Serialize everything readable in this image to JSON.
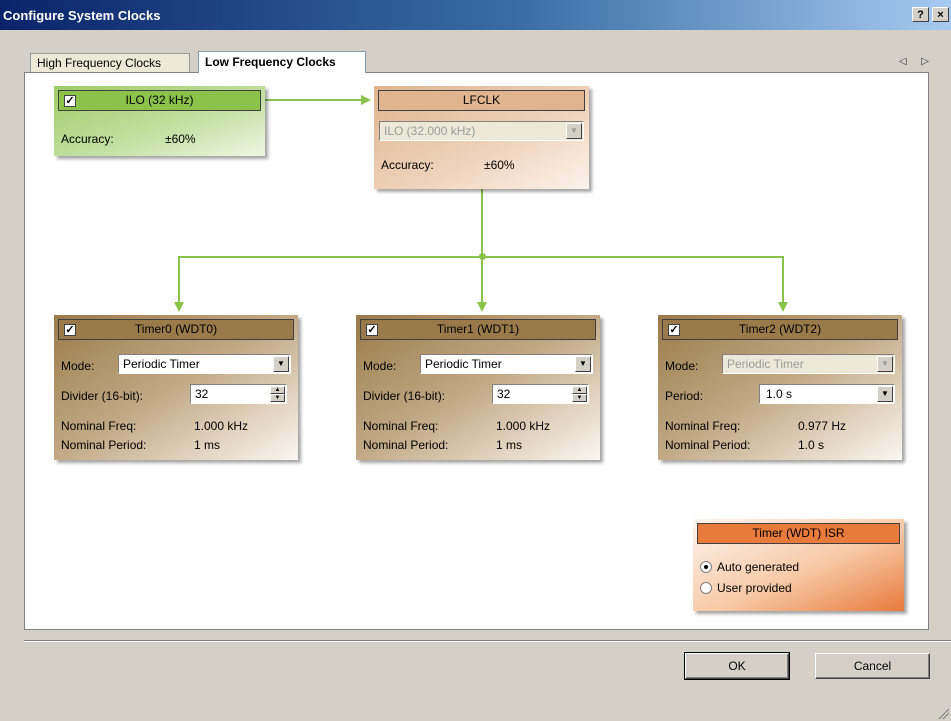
{
  "window": {
    "title": "Configure System Clocks",
    "help_label": "?",
    "close_label": "×"
  },
  "tabs": [
    {
      "label": "High Frequency Clocks",
      "active": false
    },
    {
      "label": "Low Frequency Clocks",
      "active": true
    }
  ],
  "tab_scroll": "◁ ▷",
  "ilo": {
    "header": "ILO (32 kHz)",
    "checked": true,
    "accuracy_label": "Accuracy:",
    "accuracy_value": "±60%"
  },
  "lfclk": {
    "header": "LFCLK",
    "source_value": "ILO (32.000 kHz)",
    "accuracy_label": "Accuracy:",
    "accuracy_value": "±60%"
  },
  "timers": [
    {
      "header": "Timer0 (WDT0)",
      "checked": true,
      "mode_label": "Mode:",
      "mode_value": "Periodic Timer",
      "param_label": "Divider (16-bit):",
      "param_value": "32",
      "freq_label": "Nominal Freq:",
      "freq_value": "1.000 kHz",
      "period_label": "Nominal Period:",
      "period_value": "1 ms"
    },
    {
      "header": "Timer1 (WDT1)",
      "checked": true,
      "mode_label": "Mode:",
      "mode_value": "Periodic Timer",
      "param_label": "Divider (16-bit):",
      "param_value": "32",
      "freq_label": "Nominal Freq:",
      "freq_value": "1.000 kHz",
      "period_label": "Nominal Period:",
      "period_value": "1 ms"
    },
    {
      "header": "Timer2 (WDT2)",
      "checked": true,
      "mode_label": "Mode:",
      "mode_value": "Periodic Timer",
      "param_label": "Period:",
      "param_value": "1.0 s",
      "freq_label": "Nominal Freq:",
      "freq_value": "0.977  Hz",
      "period_label": "Nominal Period:",
      "period_value": "1.0 s"
    }
  ],
  "isr": {
    "header": "Timer (WDT) ISR",
    "options": [
      "Auto generated",
      "User provided"
    ],
    "selected": "Auto generated"
  },
  "buttons": {
    "ok": "OK",
    "cancel": "Cancel"
  },
  "colors": {
    "ilo": "#8bc34a",
    "lfclk": "#e0b48e",
    "timer": "#9a7a4a",
    "isr": "#e87a3c",
    "wire": "#8bc34a"
  }
}
